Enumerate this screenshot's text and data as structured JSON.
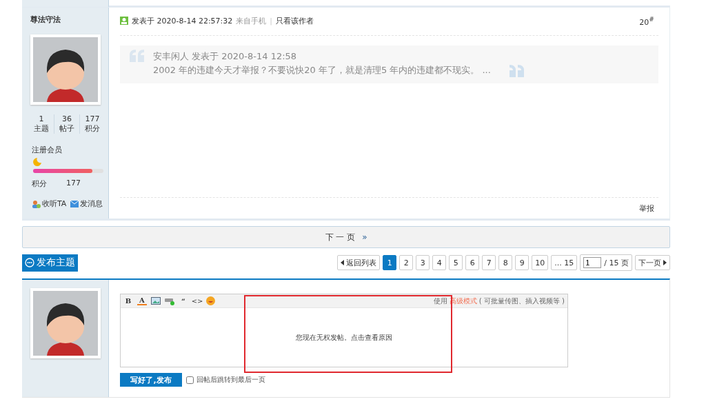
{
  "post": {
    "author": "尊法守法",
    "stats": [
      {
        "value": "1",
        "label": "主题"
      },
      {
        "value": "36",
        "label": "帖子"
      },
      {
        "value": "177",
        "label": "积分"
      }
    ],
    "rank": "注册会员",
    "level": 0.84,
    "points_label": "积分",
    "points": "177",
    "actions": [
      {
        "kind": "follow",
        "label": "收听TA"
      },
      {
        "kind": "message",
        "label": "发消息"
      }
    ],
    "posted": "发表于 2020-8-14 22:57:32",
    "source": "来自手机",
    "separator": "|",
    "author_only": "只看该作者",
    "floor": "20",
    "floor_mark": "#",
    "quote": {
      "header": "安丰闲人 发表于 2020-8-14 12:58",
      "text": "2002 年的违建今天才举报？不要说快20 年了，就是清理5 年内的违建都不现实。 ..."
    },
    "report": "举报"
  },
  "next_page": {
    "label": "下 一 页",
    "arrow": "»"
  },
  "new_thread": "发布主题",
  "pagination": {
    "back": "返回列表",
    "pages": [
      {
        "label": "1",
        "selected": true
      },
      {
        "label": "2",
        "selected": false
      },
      {
        "label": "3",
        "selected": false
      },
      {
        "label": "4",
        "selected": false
      },
      {
        "label": "5",
        "selected": false
      },
      {
        "label": "6",
        "selected": false
      },
      {
        "label": "7",
        "selected": false
      },
      {
        "label": "8",
        "selected": false
      },
      {
        "label": "9",
        "selected": false
      },
      {
        "label": "10",
        "selected": false
      },
      {
        "label": "... 15",
        "selected": false
      }
    ],
    "page_input": "1",
    "total": "/ 15 页",
    "next": "下一页"
  },
  "reply": {
    "toolbar": [
      {
        "kind": "bold",
        "glyph": "B"
      },
      {
        "kind": "color",
        "glyph": "A"
      },
      {
        "kind": "image"
      },
      {
        "kind": "link"
      },
      {
        "kind": "quote",
        "glyph": "“"
      },
      {
        "kind": "code",
        "glyph": "<>"
      },
      {
        "kind": "emoji"
      }
    ],
    "advanced_prefix": "使用",
    "advanced_link": "高级模式",
    "advanced_suffix": "( 可批量传图、插入视频等 )",
    "notice": "您现在无权发帖。点击查看原因",
    "submit": "写好了,发布",
    "jump": {
      "label": "回帖后跳转到最后一页",
      "checked": false
    }
  }
}
